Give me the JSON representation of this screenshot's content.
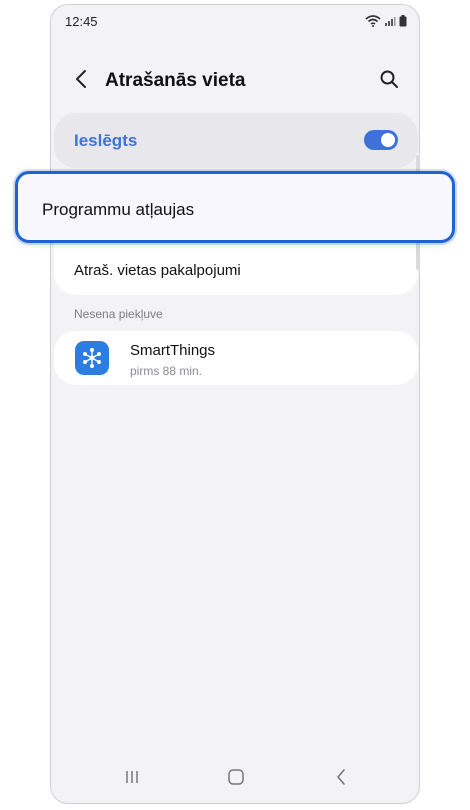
{
  "status_bar": {
    "time": "12:45"
  },
  "header": {
    "title": "Atrašanās vieta"
  },
  "location_toggle": {
    "label": "Ieslēgts",
    "state_on": true
  },
  "settings": {
    "app_permissions_label": "Programmu atļaujas",
    "location_services_label": "Atraš. vietas pakalpojumi"
  },
  "recent_access": {
    "section_title": "Nesena piekļuve",
    "items": [
      {
        "app": "SmartThings",
        "time": "pirms 88 min.",
        "icon": "smartthings-icon"
      }
    ]
  },
  "colors": {
    "accent": "#3e72d8",
    "highlight_border": "#1e63d6",
    "background": "#f3f3f6",
    "app_icon": "#2b7de2"
  },
  "navbar": {
    "icons": [
      "recents-icon",
      "home-icon",
      "back-icon"
    ]
  }
}
